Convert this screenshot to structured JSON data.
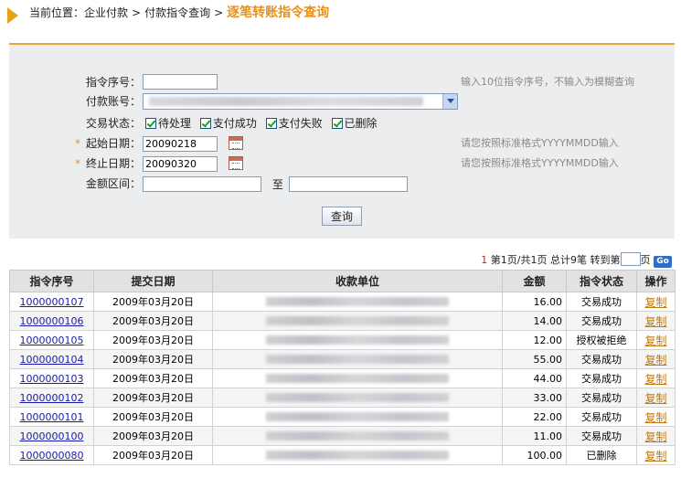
{
  "breadcrumb": {
    "prefix": "当前位置：",
    "items": [
      "企业付款",
      "付款指令查询"
    ],
    "separator": ">",
    "current": "逐笔转账指令查询"
  },
  "form": {
    "seq_label": "指令序号：",
    "seq_value": "",
    "seq_hint": "输入10位指令序号，不输入为模糊查询",
    "account_label": "付款账号：",
    "status_label": "交易状态：",
    "status_options": [
      {
        "label": "待处理",
        "checked": true
      },
      {
        "label": "支付成功",
        "checked": true
      },
      {
        "label": "支付失败",
        "checked": true
      },
      {
        "label": "已删除",
        "checked": true
      }
    ],
    "required_mark": "*",
    "start_label": "起始日期：",
    "start_value": "20090218",
    "start_hint": "请您按照标准格式YYYYMMDD输入",
    "end_label": "终止日期：",
    "end_value": "20090320",
    "end_hint": "请您按照标准格式YYYYMMDD输入",
    "amount_label": "金额区间：",
    "amount_to": "至",
    "amount_from_value": "",
    "amount_to_value": "",
    "query_button": "查询"
  },
  "pager": {
    "current": "1",
    "text": "第1页/共1页",
    "total": "总计9笔",
    "goto_prefix": "转到第",
    "goto_suffix": "页",
    "go_label": "Go"
  },
  "table": {
    "headers": [
      "指令序号",
      "提交日期",
      "收款单位",
      "金额",
      "指令状态",
      "操作"
    ],
    "rows": [
      {
        "seq": "1000000107",
        "date": "2009年03月20日",
        "amount": "16.00",
        "status": "交易成功",
        "action": "复制"
      },
      {
        "seq": "1000000106",
        "date": "2009年03月20日",
        "amount": "14.00",
        "status": "交易成功",
        "action": "复制"
      },
      {
        "seq": "1000000105",
        "date": "2009年03月20日",
        "amount": "12.00",
        "status": "授权被拒绝",
        "action": "复制"
      },
      {
        "seq": "1000000104",
        "date": "2009年03月20日",
        "amount": "55.00",
        "status": "交易成功",
        "action": "复制"
      },
      {
        "seq": "1000000103",
        "date": "2009年03月20日",
        "amount": "44.00",
        "status": "交易成功",
        "action": "复制"
      },
      {
        "seq": "1000000102",
        "date": "2009年03月20日",
        "amount": "33.00",
        "status": "交易成功",
        "action": "复制"
      },
      {
        "seq": "1000000101",
        "date": "2009年03月20日",
        "amount": "22.00",
        "status": "交易成功",
        "action": "复制"
      },
      {
        "seq": "1000000100",
        "date": "2009年03月20日",
        "amount": "11.00",
        "status": "交易成功",
        "action": "复制"
      },
      {
        "seq": "1000000080",
        "date": "2009年03月20日",
        "amount": "100.00",
        "status": "已删除",
        "action": "复制"
      }
    ]
  },
  "colors": {
    "accent": "#e8901a",
    "panel_bg": "#ecedef",
    "link": "#1a1aa8"
  }
}
